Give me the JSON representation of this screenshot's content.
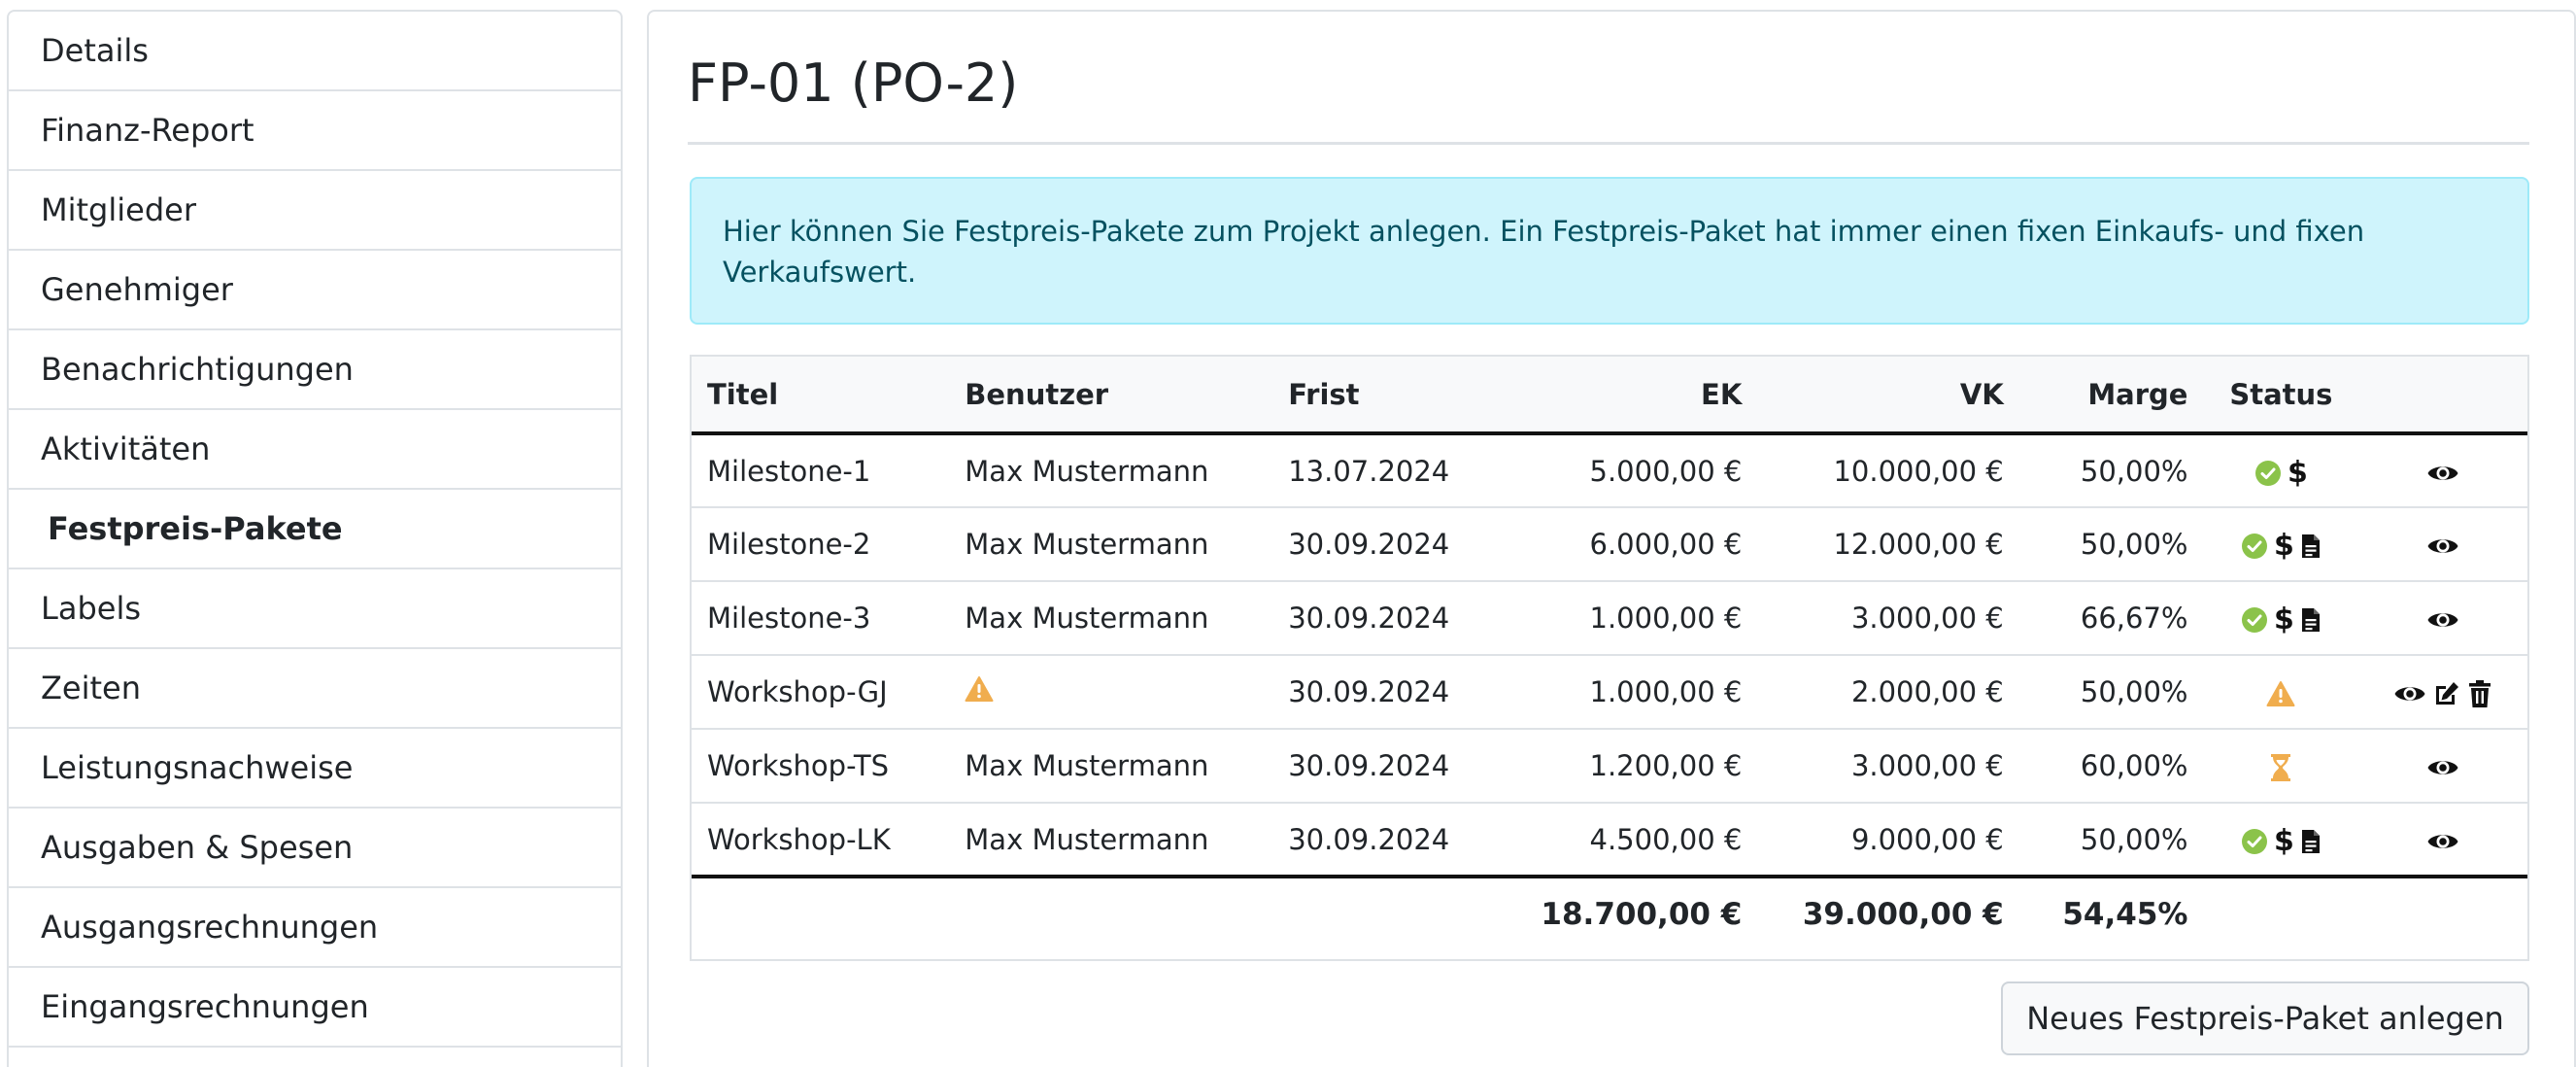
{
  "sidebar": {
    "items": [
      {
        "label": "Details"
      },
      {
        "label": "Finanz-Report"
      },
      {
        "label": "Mitglieder"
      },
      {
        "label": "Genehmiger"
      },
      {
        "label": "Benachrichtigungen"
      },
      {
        "label": "Aktivitäten"
      },
      {
        "label": "Festpreis-Pakete",
        "active": true
      },
      {
        "label": "Labels"
      },
      {
        "label": "Zeiten"
      },
      {
        "label": "Leistungsnachweise"
      },
      {
        "label": "Ausgaben & Spesen"
      },
      {
        "label": "Ausgangsrechnungen"
      },
      {
        "label": "Eingangsrechnungen"
      }
    ]
  },
  "main": {
    "title": "FP-01 (PO-2)",
    "alert_line1": "Hier können Sie Festpreis-Pakete zum Projekt anlegen. Ein Festpreis-Paket hat immer einen fixen Einkaufs- und fixen",
    "alert_line2": "Verkaufswert.",
    "table": {
      "headers": {
        "titel": "Titel",
        "benutzer": "Benutzer",
        "frist": "Frist",
        "ek": "EK",
        "vk": "VK",
        "marge": "Marge",
        "status": "Status"
      },
      "rows": [
        {
          "titel": "Milestone-1",
          "benutzer": "Max Mustermann",
          "frist": "13.07.2024",
          "ek": "5.000,00 €",
          "vk": "10.000,00 €",
          "marge": "50,00%"
        },
        {
          "titel": "Milestone-2",
          "benutzer": "Max Mustermann",
          "frist": "30.09.2024",
          "ek": "6.000,00 €",
          "vk": "12.000,00 €",
          "marge": "50,00%"
        },
        {
          "titel": "Milestone-3",
          "benutzer": "Max Mustermann",
          "frist": "30.09.2024",
          "ek": "1.000,00 €",
          "vk": "3.000,00 €",
          "marge": "66,67%"
        },
        {
          "titel": "Workshop-GJ",
          "benutzer": "",
          "frist": "30.09.2024",
          "ek": "1.000,00 €",
          "vk": "2.000,00 €",
          "marge": "50,00%"
        },
        {
          "titel": "Workshop-TS",
          "benutzer": "Max Mustermann",
          "frist": "30.09.2024",
          "ek": "1.200,00 €",
          "vk": "3.000,00 €",
          "marge": "60,00%"
        },
        {
          "titel": "Workshop-LK",
          "benutzer": "Max Mustermann",
          "frist": "30.09.2024",
          "ek": "4.500,00 €",
          "vk": "9.000,00 €",
          "marge": "50,00%"
        }
      ],
      "totals": {
        "ek": "18.700,00 €",
        "vk": "39.000,00 €",
        "marge": "54,45%"
      },
      "status_symbol": "$"
    },
    "new_button_label": "Neues Festpreis-Paket anlegen"
  },
  "colors": {
    "check_green": "#8bc34a",
    "warning_orange": "#f0ad4e",
    "alert_bg": "#cff4fc",
    "alert_text": "#055160"
  },
  "icons": {
    "check": "check-circle-icon",
    "dollar": "dollar-icon",
    "invoice": "invoice-icon",
    "warning": "warning-triangle-icon",
    "hourglass": "hourglass-icon",
    "view": "eye-icon",
    "edit": "edit-icon",
    "delete": "trash-icon"
  }
}
